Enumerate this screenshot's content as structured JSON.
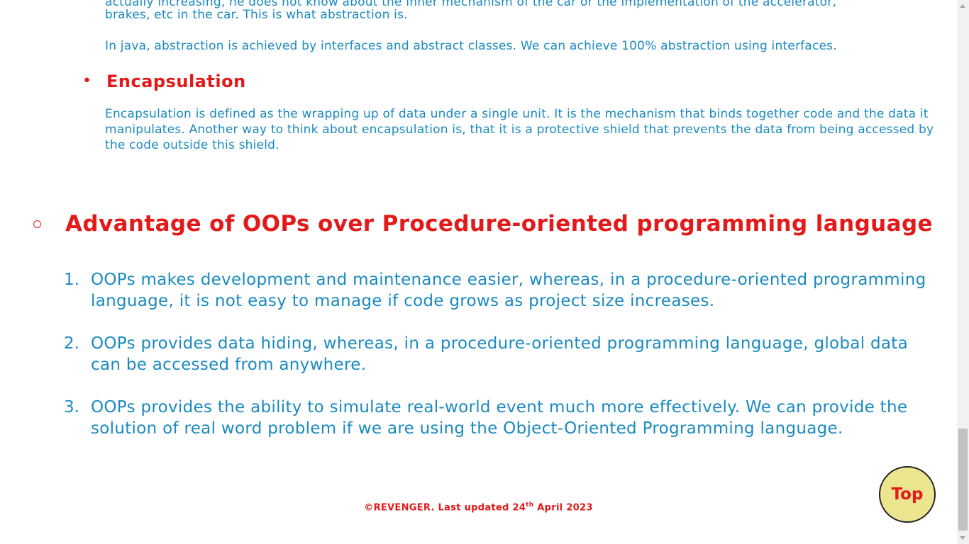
{
  "abstraction": {
    "para1_line1": "actually increasing, he does not know about the inner mechanism of the car or the implementation of the accelerator,",
    "para1_line2": "brakes, etc in the car. This is what abstraction is.",
    "para2": "In java, abstraction is achieved by interfaces and abstract classes. We can achieve 100% abstraction using interfaces."
  },
  "encapsulation": {
    "heading": "Encapsulation",
    "body": "Encapsulation is defined as the wrapping up of data under a single unit. It is the mechanism that binds together code and the data it manipulates. Another way to think about encapsulation is, that it is a protective shield that prevents the data from being accessed by the code outside this shield."
  },
  "advantages": {
    "heading": "Advantage of OOPs over Procedure-oriented programming language",
    "items": [
      {
        "num": "1.",
        "text": "OOPs makes development and maintenance easier, whereas, in a procedure-oriented programming language, it is not easy to manage if code grows as project size increases."
      },
      {
        "num": "2.",
        "text": "OOPs provides data hiding, whereas, in a procedure-oriented programming language, global data can be accessed from anywhere."
      },
      {
        "num": "3.",
        "text": "OOPs provides the ability to simulate real-world event much more effectively. We can provide the solution of real word problem if we are using the Object-Oriented Programming language."
      }
    ]
  },
  "footer": {
    "prefix": "©REVENGER. Last updated 24",
    "sup": "th",
    "suffix": " April 2023"
  },
  "top_button": {
    "label": "Top"
  },
  "colors": {
    "text_blue": "#1a8ac0",
    "heading_red": "#e21a1a",
    "top_button_bg": "#ece590"
  }
}
